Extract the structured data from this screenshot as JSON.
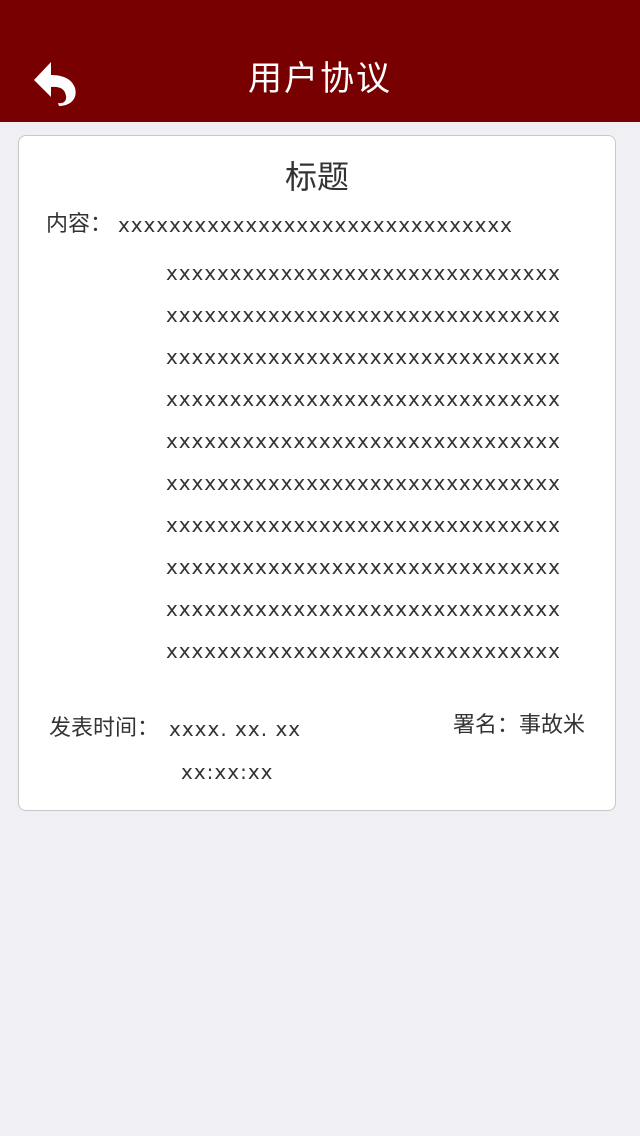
{
  "navbar": {
    "title": "用户协议",
    "back_icon": "back-arrow-icon",
    "background_color": "#780000"
  },
  "article": {
    "title": "标题",
    "content_label": "内容：",
    "content_first_line": "xxxxxxxxxxxxxxxxxxxxxxxxxxxxxxx",
    "content_lines": [
      "xxxxxxxxxxxxxxxxxxxxxxxxxxxxxxx",
      "xxxxxxxxxxxxxxxxxxxxxxxxxxxxxxx",
      "xxxxxxxxxxxxxxxxxxxxxxxxxxxxxxx",
      "xxxxxxxxxxxxxxxxxxxxxxxxxxxxxxx",
      "xxxxxxxxxxxxxxxxxxxxxxxxxxxxxxx",
      "xxxxxxxxxxxxxxxxxxxxxxxxxxxxxxx",
      "xxxxxxxxxxxxxxxxxxxxxxxxxxxxxxx",
      "xxxxxxxxxxxxxxxxxxxxxxxxxxxxxxx",
      "xxxxxxxxxxxxxxxxxxxxxxxxxxxxxxx",
      "xxxxxxxxxxxxxxxxxxxxxxxxxxxxxxx"
    ],
    "publish_label": "发表时间：",
    "publish_date": "xxxx. xx. xx",
    "publish_time": "xx:xx:xx",
    "signature": "署名：事故米"
  }
}
